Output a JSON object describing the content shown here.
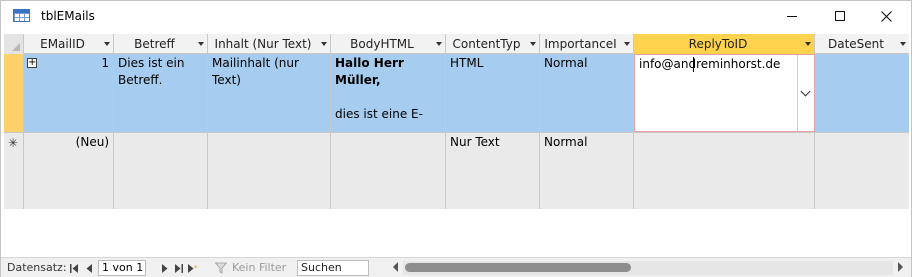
{
  "window": {
    "title": "tblEMails",
    "icon": "table-icon"
  },
  "columns": [
    {
      "label": "EMailID"
    },
    {
      "label": "Betreff"
    },
    {
      "label": "Inhalt (Nur Text)"
    },
    {
      "label": "BodyHTML"
    },
    {
      "label": "ContentTyp"
    },
    {
      "label": "ImportanceI"
    },
    {
      "label": "ReplyToID",
      "active": true
    },
    {
      "label": "DateSent"
    }
  ],
  "rows": [
    {
      "EMailID": "1",
      "Betreff": "Dies ist ein Betreff.",
      "Inhalt": "Mailinhalt (nur Text)",
      "BodyHTML_bold": "Hallo Herr Müller,",
      "BodyHTML_rest": "dies ist eine E-",
      "ContentTyp": "HTML",
      "Importance": "Normal",
      "ReplyToID": "info@andreminhorst.de",
      "DateSent": ""
    },
    {
      "EMailID": "(Neu)",
      "ContentTyp": "Nur Text",
      "Importance": "Normal"
    }
  ],
  "navigation": {
    "label": "Datensatz:",
    "position": "1 von 1",
    "filter_label": "Kein Filter",
    "search_value": "Suchen"
  },
  "colors": {
    "selected_row": "#a6cdef",
    "active_header": "#ffd34e",
    "new_row": "#eaeaea"
  }
}
